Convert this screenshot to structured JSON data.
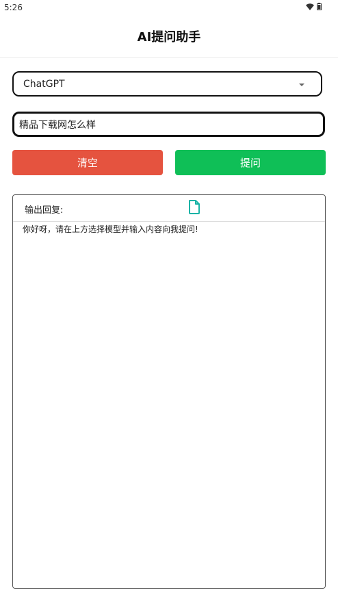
{
  "status_bar": {
    "time": "5:26",
    "icons": [
      "wifi-icon",
      "battery-icon"
    ]
  },
  "header": {
    "title": "AI提问助手"
  },
  "model_select": {
    "selected": "ChatGPT"
  },
  "question_input": {
    "placeholder": "",
    "value": "精品下载网怎么样"
  },
  "buttons": {
    "clear_label": "清空",
    "ask_label": "提问"
  },
  "output": {
    "label": "输出回复:",
    "text": "你好呀，请在上方选择模型并输入内容向我提问!"
  },
  "colors": {
    "clear_button": "#e5533f",
    "ask_button": "#0fbf57",
    "file_icon": "#1ab3a6"
  }
}
